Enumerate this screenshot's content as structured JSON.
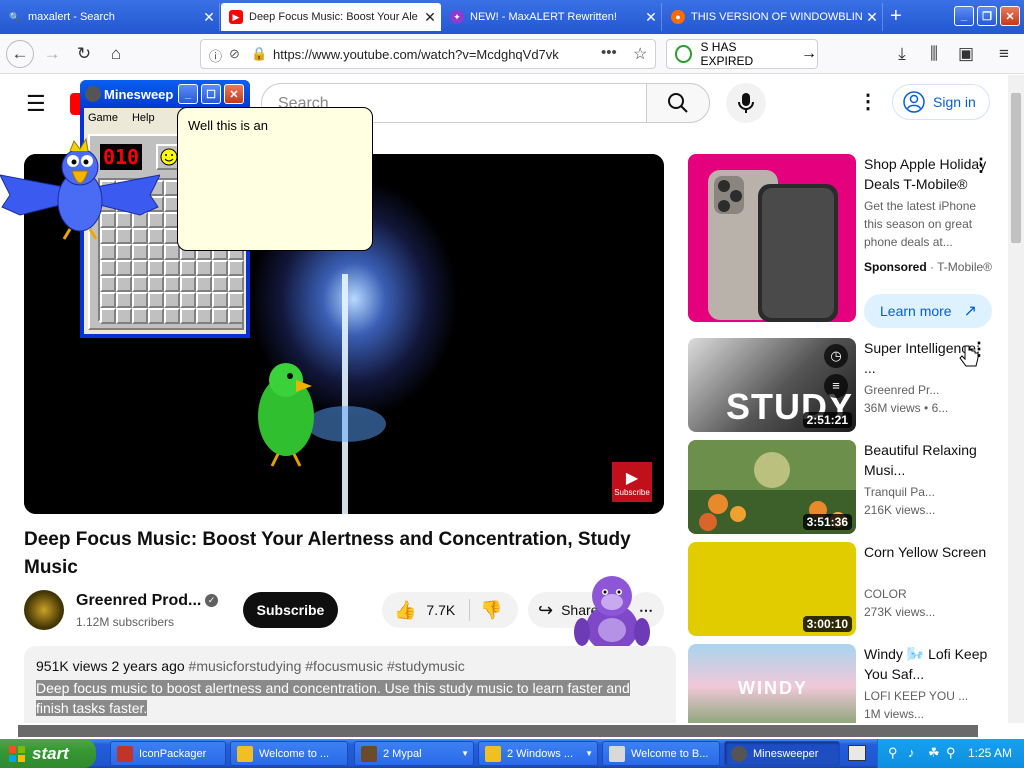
{
  "browser": {
    "tabs": [
      {
        "label": "maxalert - Search",
        "icon": "search-icon",
        "color": "#5e8dff"
      },
      {
        "label": "Deep Focus Music: Boost Your Ale",
        "icon": "youtube-icon",
        "color": "#ff0000"
      },
      {
        "label": "NEW! - MaxALERT Rewritten!",
        "icon": "globe-icon",
        "color": "#8b3bd1"
      },
      {
        "label": "THIS VERSION OF WINDOWBLIN",
        "icon": "globe-icon",
        "color": "#ff6a00"
      }
    ],
    "url": "https://www.youtube.com/watch?v=McdghqVd7vk",
    "expired_text": "S HAS EXPIRED"
  },
  "youtube": {
    "search_placeholder": "Search",
    "sign_in": "Sign in",
    "video_title": "Deep Focus Music: Boost Your Alertness and Concentration, Study Music",
    "watermark": "Subscribe",
    "channel_name": "Greenred Prod...",
    "subscribers": "1.12M subscribers",
    "subscribe_label": "Subscribe",
    "likes": "7.7K",
    "share_label": "Share",
    "views": "951K views",
    "posted": "2 years ago",
    "hashtags": "#musicforstudying #focusmusic #studymusic",
    "description": "Deep focus music to boost alertness and concentration. Use this study music to learn faster and finish tasks faster.",
    "ad": {
      "title": "Shop Apple Holiday Deals T-Mobile®",
      "body": "Get the latest iPhone this season on great phone deals at...",
      "sponsored": "Sponsored",
      "advertiser": "T-Mobile®",
      "cta": "Learn more"
    },
    "recommendations": [
      {
        "title": "Super Intelligence: ...",
        "channel": "Greenred Pr...",
        "views": "36M views",
        "age": "6...",
        "duration": "2:51:21",
        "thumb_text": "STUDY"
      },
      {
        "title": "Beautiful Relaxing Musi...",
        "channel": "Tranquil Pa...",
        "views": "216K views...",
        "age": "",
        "duration": "3:51:36",
        "thumb_text": ""
      },
      {
        "title": "Corn Yellow Screen",
        "channel": "COLOR",
        "views": "273K views...",
        "age": "",
        "duration": "3:00:10",
        "thumb_text": ""
      },
      {
        "title": "Windy 🌬️ Lofi Keep You Saf...",
        "channel": "LOFI KEEP YOU ...",
        "views": "1M views...",
        "age": "",
        "duration": "",
        "thumb_text": "WINDY"
      }
    ]
  },
  "minesweeper": {
    "title": "Minesweeper",
    "menu": [
      "Game",
      "Help"
    ],
    "counter": "010"
  },
  "bubble_text": "Well this is an",
  "taskbar": {
    "start": "start",
    "tasks": [
      {
        "label": "IconPackager",
        "active": false
      },
      {
        "label": "Welcome to ...",
        "active": false
      },
      {
        "label": "2 Mypal",
        "active": false
      },
      {
        "label": "2 Windows ...",
        "active": false
      },
      {
        "label": "Welcome to B...",
        "active": false
      },
      {
        "label": "Minesweeper",
        "active": true
      }
    ],
    "clock": "1:25 AM"
  }
}
